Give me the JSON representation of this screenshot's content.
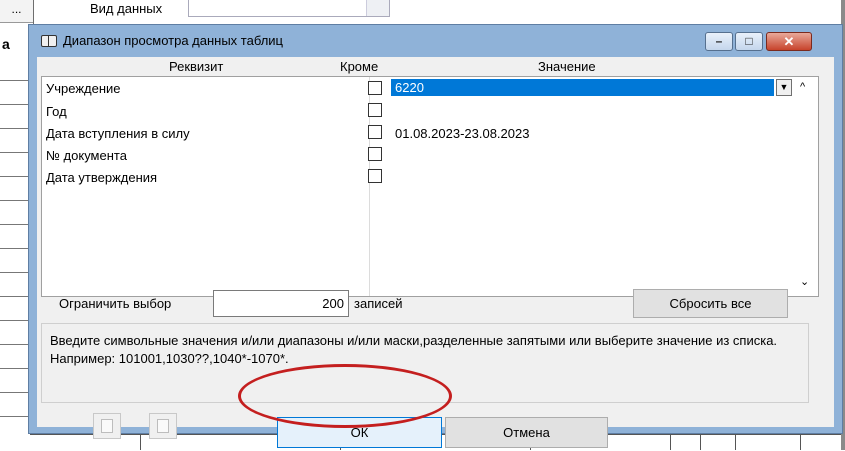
{
  "background": {
    "top_left_label": "...",
    "top_label": "Вид данных",
    "side_letter": "а"
  },
  "dialog": {
    "title": "Диапазон просмотра данных таблиц",
    "window_buttons": {
      "minimize": "–",
      "maximize": "□",
      "close": "✕"
    },
    "columns": {
      "field": "Реквизит",
      "except": "Кроме",
      "value": "Значение"
    },
    "rows": [
      {
        "label": "Учреждение",
        "value": "6220"
      },
      {
        "label": "Год",
        "value": ""
      },
      {
        "label": "Дата вступления в силу",
        "value": "01.08.2023-23.08.2023"
      },
      {
        "label": "№ документа",
        "value": ""
      },
      {
        "label": "Дата утверждения",
        "value": ""
      }
    ],
    "dropdown_arrow": "▼",
    "scroll_up": "^",
    "scroll_down": "⌄",
    "limit": {
      "label": "Ограничить выбор",
      "value": "200",
      "suffix": "записей"
    },
    "reset_button": "Сбросить все",
    "hint": "Введите символьные значения и/или диапазоны и/или маски,разделенные запятыми или выберите значение из списка. Например: 101001,1030??,1040*-1070*.",
    "ok_button": "ОК",
    "cancel_button": "Отмена"
  },
  "colors": {
    "selection": "#0078d7",
    "highlight_ellipse": "#c41f1f",
    "dialog_frame": "#8fb2d8"
  }
}
